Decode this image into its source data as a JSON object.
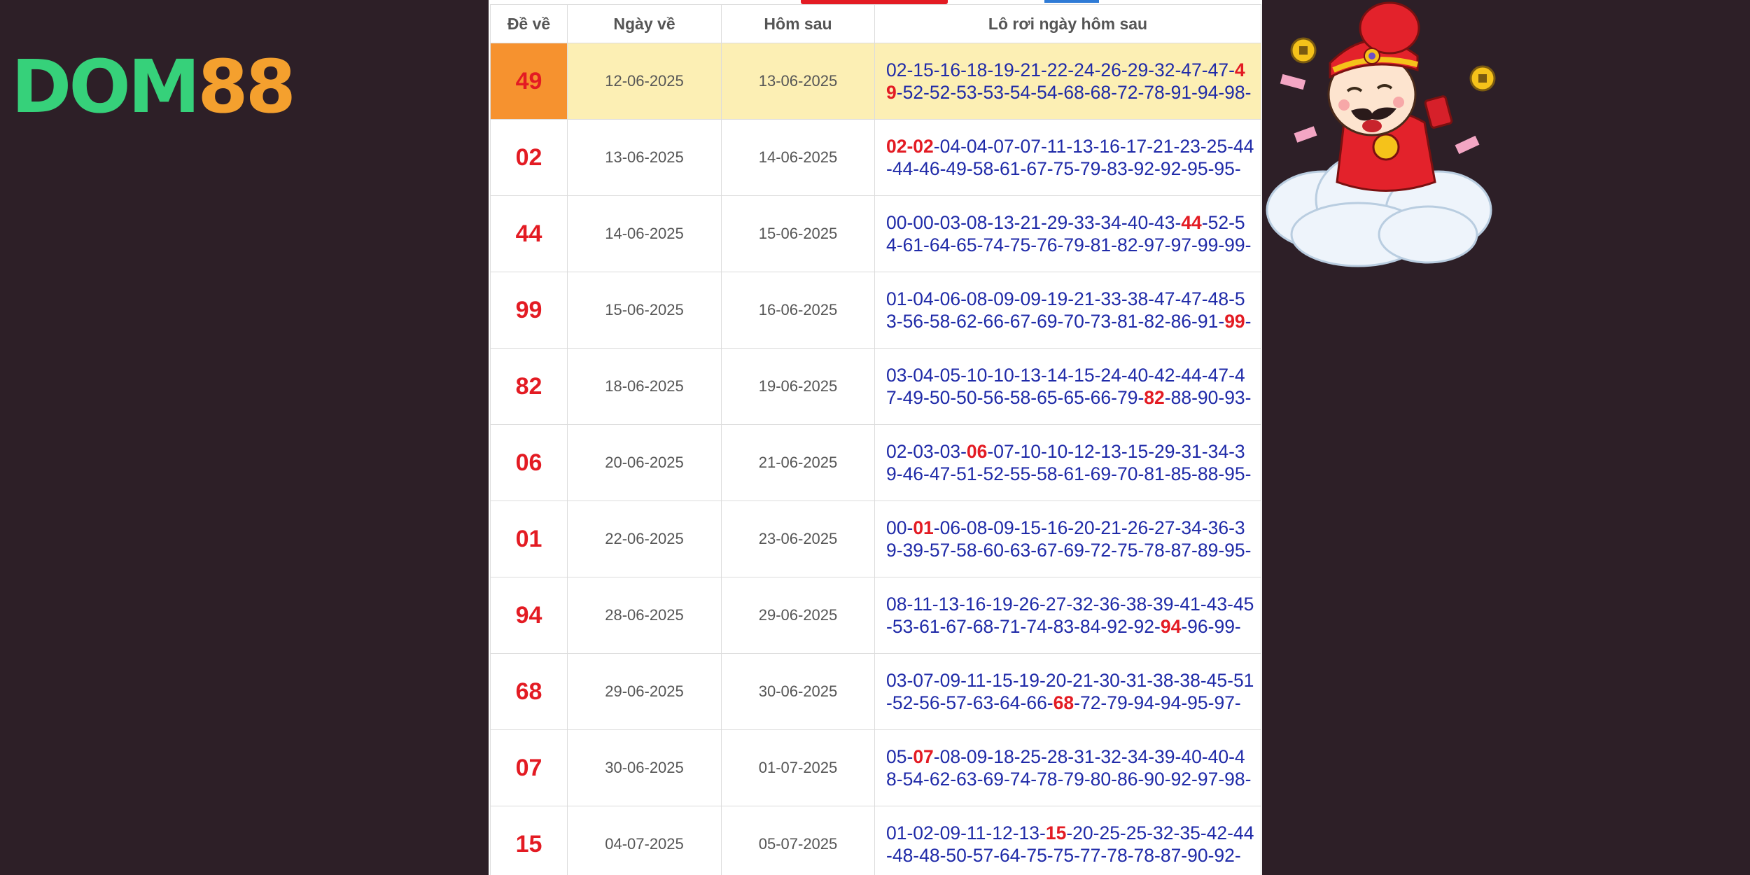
{
  "brand": {
    "logo_part1": "DOM",
    "logo_part2": "88"
  },
  "table": {
    "headers": {
      "de_ve": "Đề về",
      "ngay_ve": "Ngày về",
      "hom_sau": "Hôm sau",
      "lo_roi": "Lô rơi ngày hôm sau"
    },
    "rows": [
      {
        "de": "49",
        "ngay_ve": "12-06-2025",
        "hom_sau": "13-06-2025",
        "lo_before": "02-15-16-18-19-21-22-24-26-29-32-47-47-",
        "lo_hit": "49",
        "lo_after": "-52-52-53-53-54-54-68-68-72-78-91-94-98-"
      },
      {
        "de": "02",
        "ngay_ve": "13-06-2025",
        "hom_sau": "14-06-2025",
        "lo_before": "",
        "lo_hit": "02-02",
        "lo_after": "-04-04-07-07-11-13-16-17-21-23-25-44-44-46-49-58-61-67-75-79-83-92-92-95-95-"
      },
      {
        "de": "44",
        "ngay_ve": "14-06-2025",
        "hom_sau": "15-06-2025",
        "lo_before": "00-00-03-08-13-21-29-33-34-40-43-",
        "lo_hit": "44",
        "lo_after": "-52-54-61-64-65-74-75-76-79-81-82-97-97-99-99-"
      },
      {
        "de": "99",
        "ngay_ve": "15-06-2025",
        "hom_sau": "16-06-2025",
        "lo_before": "01-04-06-08-09-09-19-21-33-38-47-47-48-53-56-58-62-66-67-69-70-73-81-82-86-91-",
        "lo_hit": "99",
        "lo_after": "-"
      },
      {
        "de": "82",
        "ngay_ve": "18-06-2025",
        "hom_sau": "19-06-2025",
        "lo_before": "03-04-05-10-10-13-14-15-24-40-42-44-47-47-49-50-50-56-58-65-65-66-79-",
        "lo_hit": "82",
        "lo_after": "-88-90-93-"
      },
      {
        "de": "06",
        "ngay_ve": "20-06-2025",
        "hom_sau": "21-06-2025",
        "lo_before": "02-03-03-",
        "lo_hit": "06",
        "lo_after": "-07-10-10-12-13-15-29-31-34-39-46-47-51-52-55-58-61-69-70-81-85-88-95-"
      },
      {
        "de": "01",
        "ngay_ve": "22-06-2025",
        "hom_sau": "23-06-2025",
        "lo_before": "00-",
        "lo_hit": "01",
        "lo_after": "-06-08-09-15-16-20-21-26-27-34-36-39-39-57-58-60-63-67-69-72-75-78-87-89-95-"
      },
      {
        "de": "94",
        "ngay_ve": "28-06-2025",
        "hom_sau": "29-06-2025",
        "lo_before": "08-11-13-16-19-26-27-32-36-38-39-41-43-45-53-61-67-68-71-74-83-84-92-92-",
        "lo_hit": "94",
        "lo_after": "-96-99-"
      },
      {
        "de": "68",
        "ngay_ve": "29-06-2025",
        "hom_sau": "30-06-2025",
        "lo_before": "03-07-09-11-15-19-20-21-30-31-38-38-45-51-52-56-57-63-64-66-",
        "lo_hit": "68",
        "lo_after": "-72-79-94-94-95-97-"
      },
      {
        "de": "07",
        "ngay_ve": "30-06-2025",
        "hom_sau": "01-07-2025",
        "lo_before": "05-",
        "lo_hit": "07",
        "lo_after": "-08-09-18-25-28-31-32-34-39-40-40-48-54-62-63-69-74-78-79-80-86-90-92-97-98-"
      },
      {
        "de": "15",
        "ngay_ve": "04-07-2025",
        "hom_sau": "05-07-2025",
        "lo_before": "01-02-09-11-12-13-",
        "lo_hit": "15",
        "lo_after": "-20-25-25-32-35-42-44-48-48-50-57-64-75-75-77-78-78-87-90-92-"
      }
    ]
  },
  "colors": {
    "background": "#2d1f27",
    "highlight_row": "#fcefb4",
    "highlight_cell": "#f6922f",
    "hit_red": "#e31b23",
    "number_blue": "#1f2aa8"
  },
  "icons": {
    "mascot": "god-of-wealth-on-cloud-mascot"
  }
}
